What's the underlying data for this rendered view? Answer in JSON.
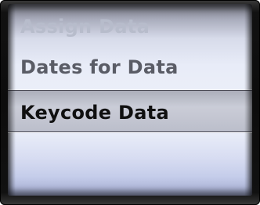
{
  "picker": {
    "items": [
      {
        "label": "Assign Data"
      },
      {
        "label": "Dates for Data"
      },
      {
        "label": "Keycode Data"
      }
    ],
    "selected_index": 2
  },
  "colors": {
    "frame": "#111111",
    "wheel_light": "#eceff9",
    "wheel_edge": "#a3abd0",
    "selected_text": "#101010",
    "unselected_text": "#5a5c66",
    "faded_text": "#b7bccb"
  }
}
